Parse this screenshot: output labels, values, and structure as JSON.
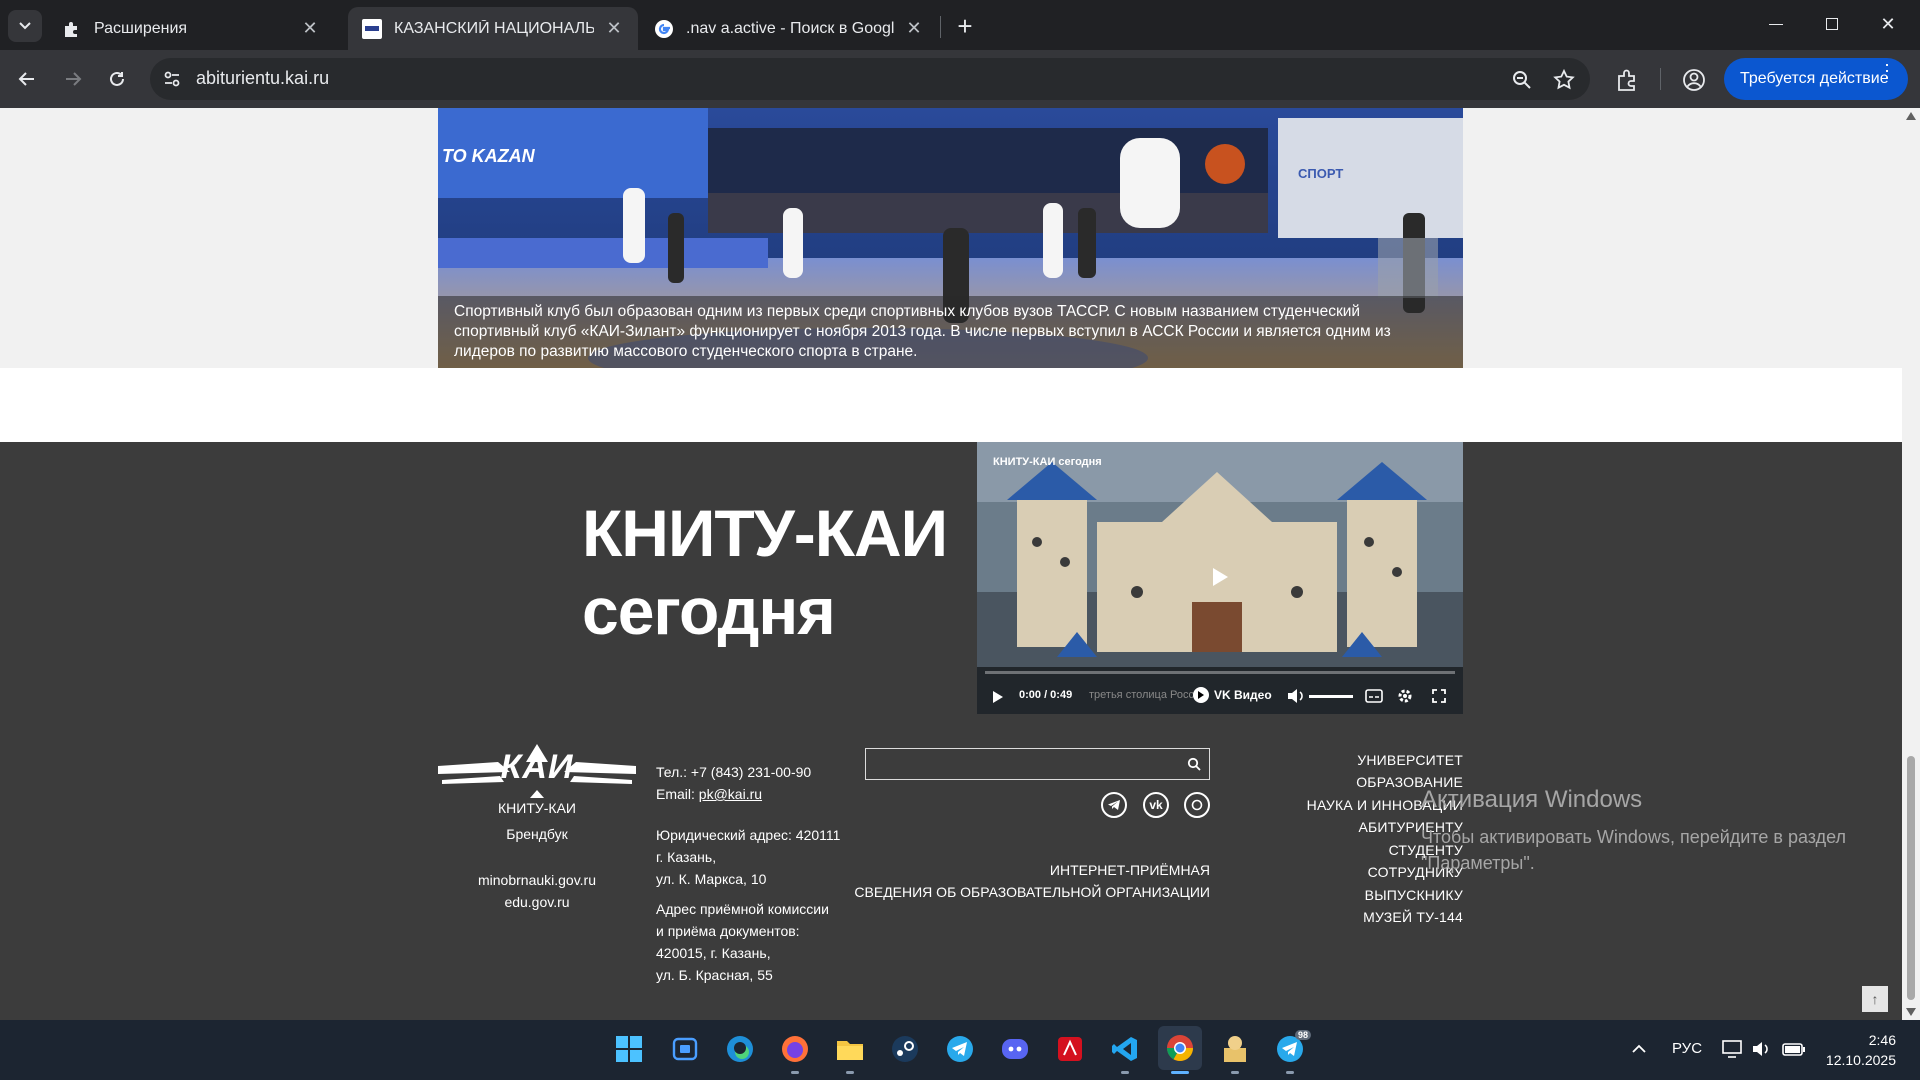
{
  "tabs": [
    {
      "title": "Расширения"
    },
    {
      "title": "КАЗАНСКИЙ НАЦИОНАЛЬНЫЙ"
    },
    {
      "title": ".nav a.active - Поиск в Google"
    }
  ],
  "address": {
    "url": "abiturientu.kai.ru"
  },
  "toolbar": {
    "action_label": "Требуется действие"
  },
  "hero": {
    "caption": "Спортивный клуб был образован одним из первых среди спортивных клубов вузов ТАССР. С новым названием студенческий спортивный клуб «КАИ-Зилант» функционирует с ноября 2013 года. В числе первых вступил в АССК России и является одним из лидеров по развитию массового студенческого спорта в стране.",
    "banner_text": "TO KAZAN",
    "court_text": "СПОРТ"
  },
  "section": {
    "title_line1": "КНИТУ-КАИ",
    "title_line2": "сегодня"
  },
  "video": {
    "overlay_title": "КНИТУ-КАИ сегодня",
    "time": "0:00 / 0:49",
    "subtitle": "третья столица России",
    "brand": "VK Видео"
  },
  "footer": {
    "logo_text": "КАИ",
    "org_name": "КНИТУ-КАИ",
    "brandbook": "Брендбук",
    "link1": "minobrnauki.gov.ru",
    "link2": "edu.gov.ru",
    "phone": "Тел.: +7 (843) 231-00-90",
    "email_label": "Email: ",
    "email": "pk@kai.ru",
    "legal_address_1": "Юридический адрес: 420111",
    "legal_address_2": "г. Казань,",
    "legal_address_3": "ул. К. Маркса, 10",
    "admission_1": "Адрес приёмной комиссии",
    "admission_2": "и приёма документов:",
    "admission_3": "420015, г. Казань,",
    "admission_4": "ул. Б. Красная, 55",
    "internet_reception": "ИНТЕРНЕТ-ПРИЁМНАЯ",
    "org_info": "СВЕДЕНИЯ ОБ ОБРАЗОВАТЕЛЬНОЙ ОРГАНИЗАЦИИ",
    "search_placeholder": "",
    "nav": [
      "УНИВЕРСИТЕТ",
      "ОБРАЗОВАНИЕ",
      "НАУКА И ИННОВАЦИИ",
      "АБИТУРИЕНТУ",
      "СТУДЕНТУ",
      "СОТРУДНИКУ",
      "ВЫПУСКНИКУ",
      "МУЗЕЙ ТУ-144"
    ]
  },
  "watermark": {
    "title": "Активация Windows",
    "text": "Чтобы активировать Windows, перейдите в раздел \"Параметры\"."
  },
  "taskbar": {
    "lang": "РУС",
    "time": "2:46",
    "date": "12.10.2025",
    "telegram_badge": "98"
  }
}
